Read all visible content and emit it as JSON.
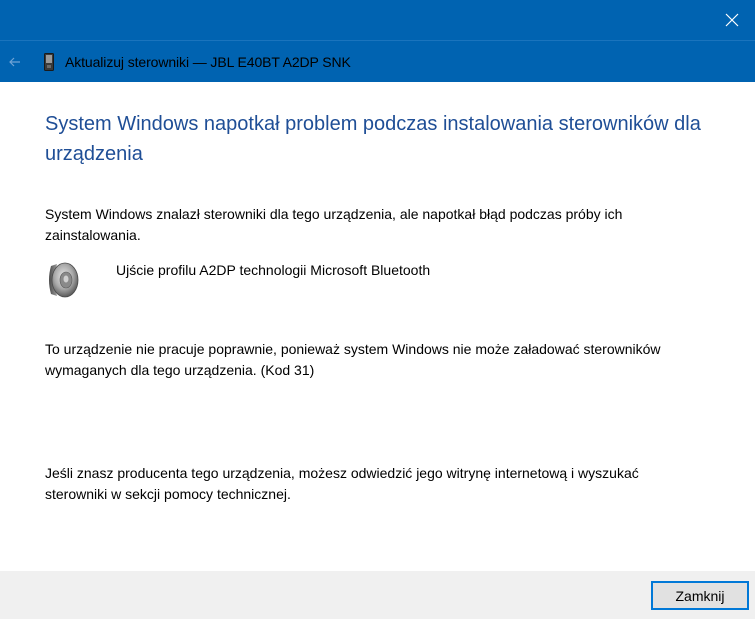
{
  "window": {
    "title": "Aktualizuj sterowniki — JBL E40BT A2DP SNK",
    "accent": "#0063b1",
    "heading_color": "#1f4e96"
  },
  "icons": {
    "close": "close-icon",
    "back": "back-arrow-icon",
    "device": "device-icon",
    "speaker": "speaker-icon"
  },
  "main": {
    "heading": "System Windows napotkał problem podczas instalowania sterowników dla urządzenia",
    "intro": "System Windows znalazł sterowniki dla tego urządzenia, ale napotkał błąd podczas próby ich zainstalowania.",
    "device_name": "Ujście profilu A2DP technologii Microsoft Bluetooth",
    "error": "To urządzenie nie pracuje poprawnie, ponieważ system Windows nie może załadować sterowników wymaganych dla tego urządzenia. (Kod 31)",
    "help": "Jeśli znasz producenta tego urządzenia, możesz odwiedzić jego witrynę internetową i wyszukać sterowniki w sekcji pomocy technicznej."
  },
  "footer": {
    "close_label": "Zamknij"
  }
}
